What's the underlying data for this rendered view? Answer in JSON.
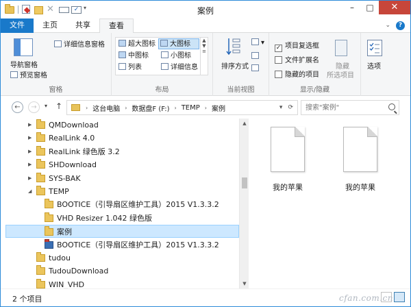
{
  "window": {
    "title": "案例",
    "minimize": "–",
    "maximize": "□",
    "close": "✕"
  },
  "tabs": {
    "file": "文件",
    "home": "主页",
    "share": "共享",
    "view": "查看"
  },
  "ribbon": {
    "panes": {
      "label": "窗格",
      "nav_pane": "导航窗格",
      "preview_pane": "预览窗格",
      "details_pane": "详细信息窗格"
    },
    "layout": {
      "label": "布局",
      "extra_large": "超大图标",
      "large": "大图标",
      "medium": "中图标",
      "small": "小图标",
      "list": "列表",
      "details": "详细信息"
    },
    "current_view": {
      "label": "当前视图",
      "sort_by": "排序方式"
    },
    "show_hide": {
      "label": "显示/隐藏",
      "item_checkboxes": "项目复选框",
      "file_extensions": "文件扩展名",
      "hidden_items": "隐藏的项目",
      "hide_selected_line1": "隐藏",
      "hide_selected_line2": "所选项目"
    },
    "options": "选项"
  },
  "address": {
    "this_pc": "这台电脑",
    "drive": "数据盘F (F:)",
    "temp": "TEMP",
    "current": "案例",
    "search_placeholder": "搜索\"案例\""
  },
  "tree": [
    {
      "label": "QMDownload",
      "expanded": false,
      "level": 0
    },
    {
      "label": "RealLink 4.0",
      "expanded": false,
      "level": 0
    },
    {
      "label": "RealLink 绿色版 3.2",
      "expanded": false,
      "level": 0
    },
    {
      "label": "SHDownload",
      "expanded": false,
      "level": 0
    },
    {
      "label": "SYS-BAK",
      "expanded": false,
      "level": 0
    },
    {
      "label": "TEMP",
      "expanded": true,
      "level": 0
    },
    {
      "label": "BOOTICE（引导扇区维护工具）2015 V1.3.3.2",
      "level": 1
    },
    {
      "label": "VHD Resizer 1.042 绿色版",
      "level": 1
    },
    {
      "label": "案例",
      "level": 1,
      "selected": true
    },
    {
      "label": "BOOTICE（引导扇区维护工具）2015 V1.3.3.2",
      "level": 1,
      "app": true
    },
    {
      "label": "tudou",
      "level": 0
    },
    {
      "label": "TudouDownload",
      "level": 0
    },
    {
      "label": "WIN_VHD",
      "level": 0
    }
  ],
  "files": [
    {
      "name": "我的苹果"
    },
    {
      "name": "我的苹果"
    }
  ],
  "status": {
    "item_count": "2 个项目"
  },
  "watermark": "cfan.com.cn",
  "colors": {
    "accent": "#1979ca",
    "selection": "#cde8ff",
    "close": "#c7463a"
  }
}
